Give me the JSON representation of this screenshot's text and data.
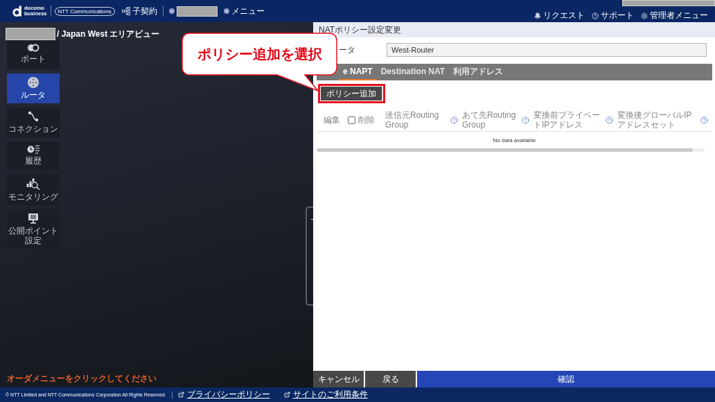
{
  "header": {
    "logo": {
      "line_1": "docomo",
      "line_2": "business",
      "partner": "NTT Communications"
    },
    "contract_link": "子契約",
    "menu_link": "メニュー",
    "utility_links": [
      {
        "kind": "request",
        "label": "リクエスト"
      },
      {
        "kind": "support",
        "label": "サポート"
      },
      {
        "kind": "admin",
        "label": "管理者メニュー"
      }
    ]
  },
  "area_view": {
    "title": "/ Japan West エリアビュー",
    "sidebar": [
      {
        "kind": "port",
        "label": "ポート",
        "selected": false
      },
      {
        "kind": "router",
        "label": "ルータ",
        "selected": true
      },
      {
        "kind": "connection",
        "label": "コネクション",
        "selected": false
      },
      {
        "kind": "history",
        "label": "履歴",
        "selected": false
      },
      {
        "kind": "monitoring",
        "label": "モニタリング",
        "selected": false
      },
      {
        "kind": "public_point",
        "label": "公開ポイント設定",
        "selected": false
      }
    ],
    "hint": "オーダメニューをクリックしてください"
  },
  "dialog": {
    "title": "NATポリシー設定変更",
    "router_field": {
      "label": "ータ",
      "value": "West-Router"
    },
    "tabs": [
      {
        "label": "e NAPT",
        "selected": true
      },
      {
        "label": "Destination NAT",
        "selected": false
      },
      {
        "label": "利用アドレス",
        "selected": false
      }
    ],
    "add_button": {
      "label": "ポリシー追加",
      "highlighted": true
    },
    "table": {
      "columns": [
        {
          "kind": "plain",
          "label": "編集",
          "help": false
        },
        {
          "kind": "checkbox",
          "label": "削除",
          "checked": false,
          "help": false
        },
        {
          "kind": "plain",
          "label": "送信元Routing Group",
          "help": true
        },
        {
          "kind": "plain",
          "label": "あて先Routing Group",
          "help": true
        },
        {
          "kind": "plain",
          "label": "変換前プライベートIPアドレス",
          "help": true
        },
        {
          "kind": "plain",
          "label": "変換後グローバルIPアドレスセット",
          "help": true
        }
      ],
      "empty_message": "No data available"
    },
    "buttons": [
      {
        "kind": "secondary",
        "label": "キャンセル"
      },
      {
        "kind": "secondary",
        "label": "戻る"
      },
      {
        "kind": "primary",
        "label": "確認"
      }
    ]
  },
  "callout": {
    "text": "ポリシー追加を選択"
  },
  "footer": {
    "copyright": "© NTT Limited and NTT Communications Corporation All Rights Reserved.",
    "links": [
      "プライバシーポリシー",
      "サイトのご利用条件"
    ]
  }
}
